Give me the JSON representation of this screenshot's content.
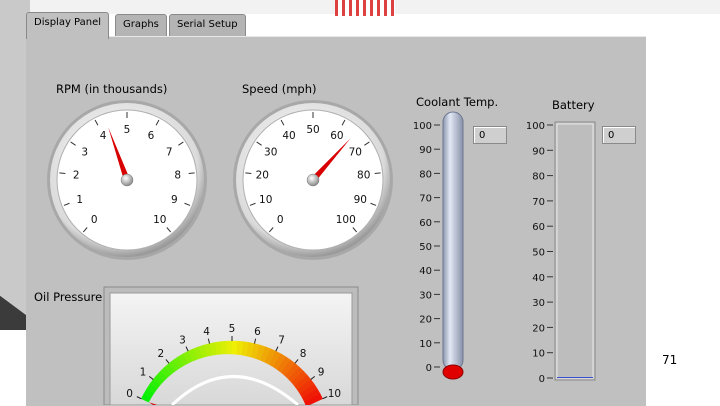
{
  "tabs": [
    {
      "label": "Display Panel",
      "active": true
    },
    {
      "label": "Graphs",
      "active": false
    },
    {
      "label": "Serial Setup",
      "active": false
    }
  ],
  "rpm": {
    "label": "RPM (in thousands)",
    "min": 0,
    "max": 10,
    "value": 4.3,
    "ticks": [
      "0",
      "1",
      "2",
      "3",
      "4",
      "5",
      "6",
      "7",
      "8",
      "9",
      "10"
    ]
  },
  "speed": {
    "label": "Speed (mph)",
    "min": 0,
    "max": 100,
    "value": 65,
    "ticks": [
      "0",
      "10",
      "20",
      "30",
      "40",
      "50",
      "60",
      "70",
      "80",
      "90",
      "100"
    ]
  },
  "coolant": {
    "label": "Coolant Temp.",
    "min": 0,
    "max": 100,
    "value": 0,
    "display": "0",
    "ticks": [
      "0",
      "10",
      "20",
      "30",
      "40",
      "50",
      "60",
      "70",
      "80",
      "90",
      "100"
    ]
  },
  "battery": {
    "label": "Battery",
    "min": 0,
    "max": 100,
    "value": 0,
    "display": "0",
    "ticks": [
      "0",
      "10",
      "20",
      "30",
      "40",
      "50",
      "60",
      "70",
      "80",
      "90",
      "100"
    ]
  },
  "oil": {
    "label": "Oil Pressure",
    "min": 0,
    "max": 10,
    "value": 0,
    "ticks": [
      "0",
      "1",
      "2",
      "3",
      "4",
      "5",
      "6",
      "7",
      "8",
      "9",
      "10"
    ]
  },
  "page_number": "71",
  "colors": {
    "needle": "#d80000",
    "panel": "#c0c0c0",
    "track": "#b8c4d8",
    "bulb": "#e00000"
  }
}
